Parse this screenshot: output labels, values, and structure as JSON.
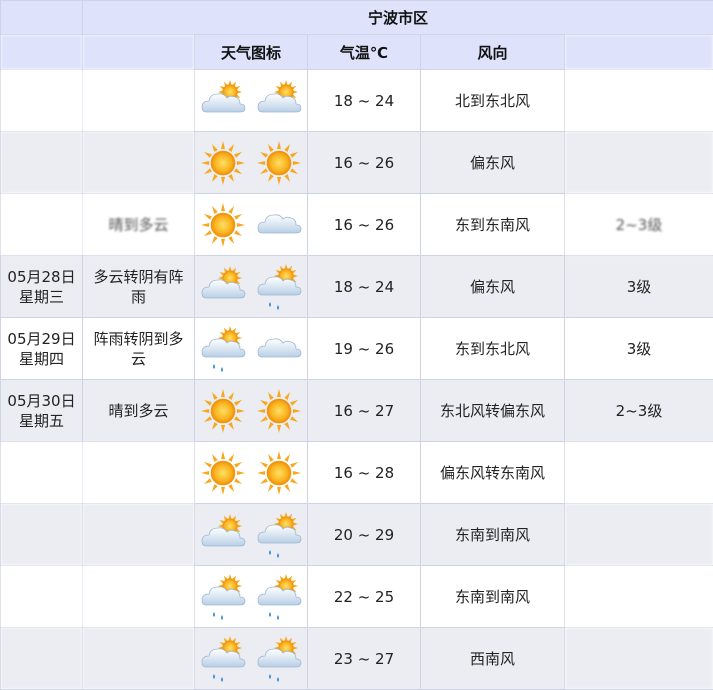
{
  "region": "宁波市区",
  "headers": {
    "date": "",
    "weather": "",
    "icon": "天气图标",
    "temp": "气温℃",
    "wind_dir": "风向",
    "wind_force": ""
  },
  "rows": [
    {
      "date1": "",
      "date2": "",
      "weather": "",
      "icons": [
        "partly-cloudy-icon",
        "partly-cloudy-icon"
      ],
      "temp": "18 ~ 24",
      "wind_dir": "北到东北风",
      "wind_force": "",
      "blur": true
    },
    {
      "date1": "",
      "date2": "",
      "weather": "",
      "icons": [
        "sun-icon",
        "sun-icon"
      ],
      "temp": "16 ~ 26",
      "wind_dir": "偏东风",
      "wind_force": "",
      "blur": true
    },
    {
      "date1": "",
      "date2": "",
      "weather": "晴到多云",
      "icons": [
        "sun-icon",
        "cloudy-icon"
      ],
      "temp": "16 ~ 26",
      "wind_dir": "东到东南风",
      "wind_force": "2~3级",
      "blur": true
    },
    {
      "date1": "05月28日",
      "date2": "星期三",
      "weather": "多云转阴有阵雨",
      "icons": [
        "partly-cloudy-icon",
        "shower-icon"
      ],
      "temp": "18 ~ 24",
      "wind_dir": "偏东风",
      "wind_force": "3级",
      "blur": false
    },
    {
      "date1": "05月29日",
      "date2": "星期四",
      "weather": "阵雨转阴到多云",
      "icons": [
        "rain-icon",
        "cloudy-icon"
      ],
      "temp": "19 ~ 26",
      "wind_dir": "东到东北风",
      "wind_force": "3级",
      "blur": false
    },
    {
      "date1": "05月30日",
      "date2": "星期五",
      "weather": "晴到多云",
      "icons": [
        "sun-icon",
        "sun-icon"
      ],
      "temp": "16 ~ 27",
      "wind_dir": "东北风转偏东风",
      "wind_force": "2~3级",
      "blur": false
    },
    {
      "date1": "",
      "date2": "",
      "weather": "",
      "icons": [
        "sun-icon",
        "sun-icon"
      ],
      "temp": "16 ~ 28",
      "wind_dir": "偏东风转东南风",
      "wind_force": "",
      "blur": true
    },
    {
      "date1": "",
      "date2": "",
      "weather": "",
      "icons": [
        "partly-cloudy-icon",
        "shower-icon"
      ],
      "temp": "20 ~ 29",
      "wind_dir": "东南到南风",
      "wind_force": "",
      "blur": true
    },
    {
      "date1": "",
      "date2": "",
      "weather": "",
      "icons": [
        "shower-icon",
        "shower-icon"
      ],
      "temp": "22 ~ 25",
      "wind_dir": "东南到南风",
      "wind_force": "",
      "blur": true
    },
    {
      "date1": "",
      "date2": "",
      "weather": "",
      "icons": [
        "rain-icon",
        "rain-icon"
      ],
      "temp": "23 ~ 27",
      "wind_dir": "西南风",
      "wind_force": "",
      "blur": true
    }
  ],
  "colors": {
    "header_bg": "#dfe2fb",
    "row_alt_bg": "#ecedf2",
    "sun": "#f7a81c",
    "cloud": "#cfe0f2",
    "rain": "#3d8fd8"
  }
}
